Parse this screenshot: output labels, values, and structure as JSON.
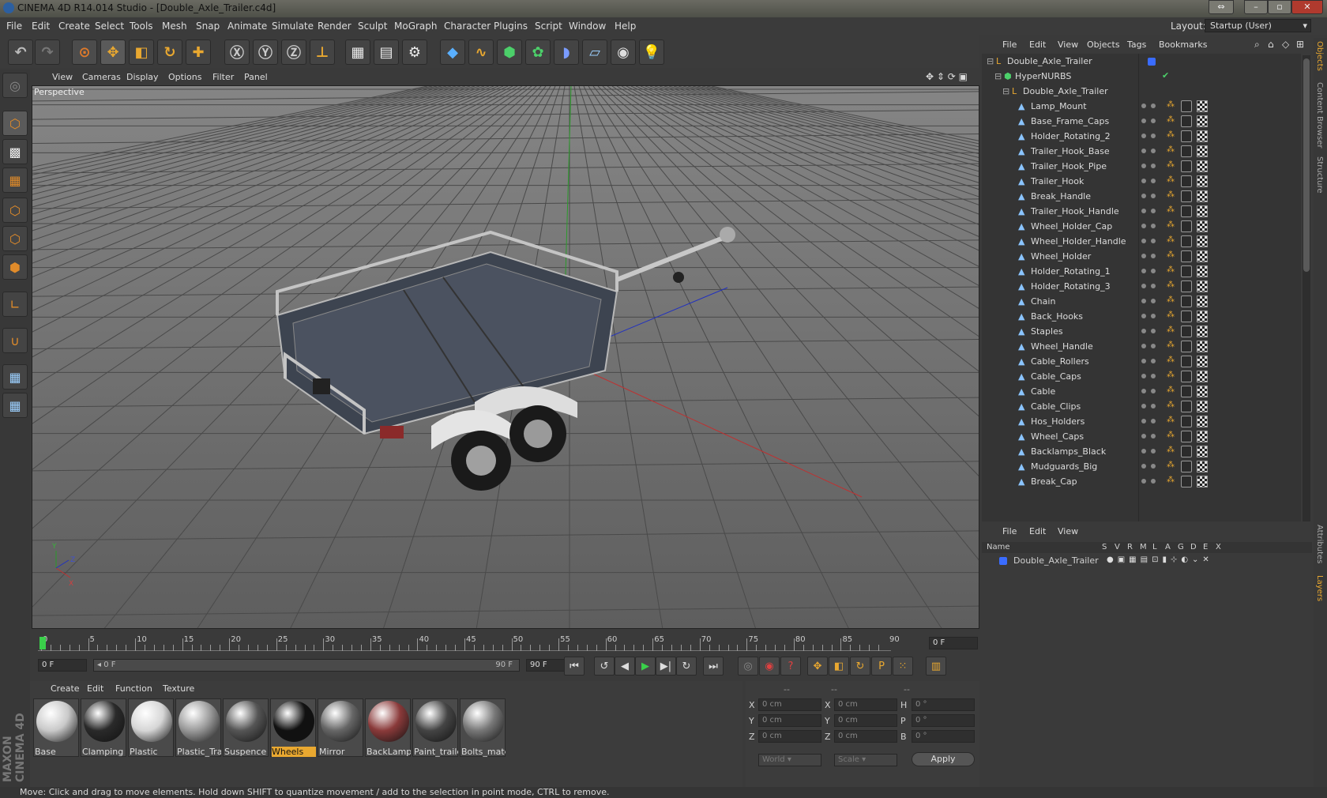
{
  "window": {
    "title": "CINEMA 4D R14.014 Studio - [Double_Axle_Trailer.c4d]",
    "layout_label": "Layout:",
    "layout_value": "Startup (User)"
  },
  "menu": [
    "File",
    "Edit",
    "Create",
    "Select",
    "Tools",
    "Mesh",
    "Snap",
    "Animate",
    "Simulate",
    "Render",
    "Sculpt",
    "MoGraph",
    "Character",
    "Plugins",
    "Script",
    "Window",
    "Help"
  ],
  "toolbar_icons": [
    "undo-icon",
    "redo-icon",
    "live-select-icon",
    "move-icon",
    "scale-icon",
    "rotate-icon",
    "add-icon",
    "x-axis-icon",
    "y-axis-icon",
    "z-axis-icon",
    "coordinate-system-icon",
    "render-view-icon",
    "render-picture-viewer-icon",
    "render-settings-icon",
    "cube-icon",
    "spline-icon",
    "nurbs-icon",
    "array-icon",
    "deformer-icon",
    "floor-icon",
    "camera-icon",
    "light-icon"
  ],
  "viewport": {
    "menu": [
      "View",
      "Cameras",
      "Display",
      "Options",
      "Filter",
      "Panel"
    ],
    "label": "Perspective"
  },
  "timeline": {
    "ticks": [
      "0",
      "5",
      "10",
      "15",
      "20",
      "25",
      "30",
      "35",
      "40",
      "45",
      "50",
      "55",
      "60",
      "65",
      "70",
      "75",
      "80",
      "85",
      "90"
    ],
    "current_frame": "0 F",
    "start_frame": "0 F",
    "slider_left": "0 F",
    "slider_right": "90 F",
    "end_frame": "90 F"
  },
  "materials": {
    "menu": [
      "Create",
      "Edit",
      "Function",
      "Texture"
    ],
    "items": [
      {
        "name": "Base",
        "color": "#c9c9c9"
      },
      {
        "name": "Clamping",
        "color": "#2a2a2a"
      },
      {
        "name": "Plastic",
        "color": "#d6d6d6"
      },
      {
        "name": "Plastic_Trar",
        "color": "#9a9a9a"
      },
      {
        "name": "Suspence",
        "color": "#555"
      },
      {
        "name": "Wheels",
        "color": "#111",
        "selected": true
      },
      {
        "name": "Mirror",
        "color": "#666"
      },
      {
        "name": "BackLamps",
        "color": "#8a3a3a"
      },
      {
        "name": "Paint_traile",
        "color": "#444"
      },
      {
        "name": "Bolts_mate",
        "color": "#777"
      }
    ]
  },
  "coords": {
    "headers": [
      "--",
      "--",
      "--"
    ],
    "rows": [
      {
        "a": "X",
        "av": "0 cm",
        "b": "X",
        "bv": "0 cm",
        "c": "H",
        "cv": "0 °"
      },
      {
        "a": "Y",
        "av": "0 cm",
        "b": "Y",
        "bv": "0 cm",
        "c": "P",
        "cv": "0 °"
      },
      {
        "a": "Z",
        "av": "0 cm",
        "b": "Z",
        "bv": "0 cm",
        "c": "B",
        "cv": "0 °"
      }
    ],
    "world": "World",
    "scale": "Scale",
    "apply": "Apply"
  },
  "objects": {
    "menu": [
      "File",
      "Edit",
      "View",
      "Objects",
      "Tags",
      "Bookmarks"
    ],
    "root": "Double_Axle_Trailer",
    "hypernurbs": "HyperNURBS",
    "group": "Double_Axle_Trailer",
    "items": [
      "Lamp_Mount",
      "Base_Frame_Caps",
      "Holder_Rotating_2",
      "Trailer_Hook_Base",
      "Trailer_Hook_Pipe",
      "Trailer_Hook",
      "Break_Handle",
      "Trailer_Hook_Handle",
      "Wheel_Holder_Cap",
      "Wheel_Holder_Handle",
      "Wheel_Holder",
      "Holder_Rotating_1",
      "Holder_Rotating_3",
      "Chain",
      "Back_Hooks",
      "Staples",
      "Wheel_Handle",
      "Cable_Rollers",
      "Cable_Caps",
      "Cable",
      "Cable_Clips",
      "Hos_Holders",
      "Wheel_Caps",
      "Backlamps_Black",
      "Mudguards_Big",
      "Break_Cap"
    ]
  },
  "layers": {
    "menu": [
      "File",
      "Edit",
      "View"
    ],
    "col_name": "Name",
    "cols": [
      "S",
      "V",
      "R",
      "M",
      "L",
      "A",
      "G",
      "D",
      "E",
      "X"
    ],
    "rows": [
      "Double_Axle_Trailer"
    ]
  },
  "side_tabs": [
    "Objects",
    "Content Browser",
    "Structure",
    "Attributes",
    "Layers"
  ],
  "status": "Move: Click and drag to move elements. Hold down SHIFT to quantize movement / add to the selection in point mode, CTRL to remove.",
  "brand": "MAXON CINEMA 4D"
}
